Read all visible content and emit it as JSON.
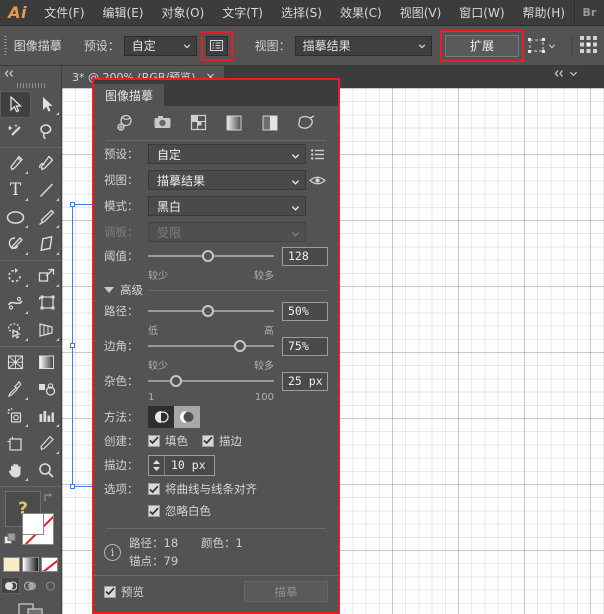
{
  "app": {
    "logo": "Ai",
    "bridge_logo": "Br",
    "menus": [
      "文件(F)",
      "编辑(E)",
      "对象(O)",
      "文字(T)",
      "选择(S)",
      "效果(C)",
      "视图(V)",
      "窗口(W)",
      "帮助(H)"
    ]
  },
  "control_bar": {
    "title": "图像描摹",
    "preset_label": "预设：",
    "preset_value": "自定",
    "panel_toggle_icon": "trace-options-icon",
    "view_label": "视图：",
    "view_value": "描摹结果",
    "expand_label": "扩展",
    "artboard_icon": "artboard-select-icon",
    "arrange_icon": "arrange-documents-icon"
  },
  "toolbar": {
    "collapse_icon": "collapse-arrows-icon",
    "tools": [
      {
        "name": "selection-tool",
        "selected": true,
        "corner": false
      },
      {
        "name": "direct-selection-tool",
        "selected": false,
        "corner": true
      },
      {
        "name": "magic-wand-tool",
        "selected": false,
        "corner": false
      },
      {
        "name": "lasso-tool",
        "selected": false,
        "corner": false
      },
      {
        "name": "pen-tool",
        "selected": false,
        "corner": true
      },
      {
        "name": "curvature-tool",
        "selected": false,
        "corner": false
      },
      {
        "name": "type-tool",
        "selected": false,
        "corner": true
      },
      {
        "name": "line-segment-tool",
        "selected": false,
        "corner": true
      },
      {
        "name": "ellipse-tool",
        "selected": false,
        "corner": true
      },
      {
        "name": "paintbrush-tool",
        "selected": false,
        "corner": true
      },
      {
        "name": "shaper-tool",
        "selected": false,
        "corner": true
      },
      {
        "name": "eraser-tool",
        "selected": false,
        "corner": true
      },
      {
        "name": "rotate-tool",
        "selected": false,
        "corner": true
      },
      {
        "name": "scale-tool",
        "selected": false,
        "corner": true
      },
      {
        "name": "width-tool",
        "selected": false,
        "corner": true
      },
      {
        "name": "free-transform-tool",
        "selected": false,
        "corner": false
      },
      {
        "name": "shape-builder-tool",
        "selected": false,
        "corner": true
      },
      {
        "name": "perspective-grid-tool",
        "selected": false,
        "corner": true
      },
      {
        "name": "mesh-tool",
        "selected": false,
        "corner": false
      },
      {
        "name": "gradient-tool",
        "selected": false,
        "corner": false
      },
      {
        "name": "eyedropper-tool",
        "selected": false,
        "corner": true
      },
      {
        "name": "blend-tool",
        "selected": false,
        "corner": false
      },
      {
        "name": "symbol-sprayer-tool",
        "selected": false,
        "corner": true
      },
      {
        "name": "column-graph-tool",
        "selected": false,
        "corner": true
      },
      {
        "name": "artboard-tool",
        "selected": false,
        "corner": false
      },
      {
        "name": "slice-tool",
        "selected": false,
        "corner": true
      },
      {
        "name": "hand-tool",
        "selected": false,
        "corner": true
      },
      {
        "name": "zoom-tool",
        "selected": false,
        "corner": false
      }
    ],
    "help_glyph": "?",
    "swatches": [
      "fill-color-swatch",
      "gradient-swatch",
      "none-swatch"
    ],
    "draw_modes": [
      "draw-normal",
      "draw-behind",
      "draw-inside"
    ],
    "screen_mode_icon": "screen-mode-icon"
  },
  "document": {
    "tab_title": "3* @ 200% (RGB/预览)",
    "close_label": "×"
  },
  "panel": {
    "tab_title": "图像描摹",
    "toolbar_icons": [
      "auto-color-icon",
      "high-color-icon",
      "low-color-icon",
      "grayscale-icon",
      "black-white-icon",
      "outline-icon"
    ],
    "preset": {
      "label": "预设：",
      "value": "自定",
      "menu_icon": "panel-menu-icon"
    },
    "view": {
      "label": "视图：",
      "value": "描摹结果",
      "eye_icon": "eye-icon"
    },
    "mode": {
      "label": "模式：",
      "value": "黑白"
    },
    "palette": {
      "label": "调板：",
      "value": "受限",
      "disabled": true
    },
    "threshold": {
      "label": "阈值：",
      "value": "128",
      "percent": 48,
      "min_label": "较少",
      "max_label": "较多"
    },
    "advanced": {
      "label": "高级",
      "expanded": true
    },
    "paths": {
      "label": "路径：",
      "value": "50%",
      "percent": 48,
      "min_label": "低",
      "max_label": "高"
    },
    "corners": {
      "label": "边角：",
      "value": "75%",
      "percent": 73,
      "min_label": "较少",
      "max_label": "较多"
    },
    "noise": {
      "label": "杂色：",
      "value": "25 px",
      "percent": 22,
      "min_label": "1",
      "max_label": "100"
    },
    "method": {
      "label": "方法：",
      "options": [
        "abutting-method-icon",
        "overlapping-method-icon"
      ],
      "selected_index": 0
    },
    "create": {
      "label": "创建：",
      "fill": {
        "label": "填色",
        "checked": true
      },
      "stroke": {
        "label": "描边",
        "checked": true
      }
    },
    "stroke_width": {
      "label": "描边：",
      "value": "10 px"
    },
    "options": {
      "label": "选项：",
      "snap_curves": {
        "label": "将曲线与线条对齐",
        "checked": true
      },
      "ignore_white": {
        "label": "忽略白色",
        "checked": true
      }
    },
    "info": {
      "icon": "info-icon",
      "paths_label": "路径：",
      "paths_value": "18",
      "colors_label": "颜色：",
      "colors_value": "1",
      "anchors_label": "锚点：",
      "anchors_value": "79"
    },
    "footer": {
      "preview": {
        "label": "预览",
        "checked": true
      },
      "trace_button": {
        "label": "描摹",
        "disabled": true
      }
    }
  },
  "artwork": {
    "fill_color": "#F5A623",
    "stroke_color": "#000000",
    "selection_color": "#3d7ee8"
  }
}
